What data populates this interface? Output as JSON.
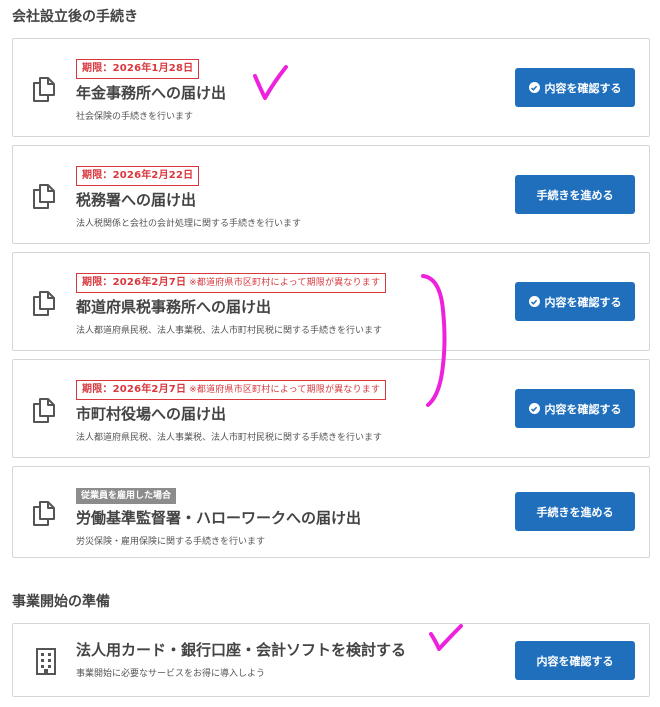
{
  "section1": {
    "title": "会社設立後の手続き"
  },
  "section2": {
    "title": "事業開始の準備"
  },
  "cards": [
    {
      "deadline": "期限：2026年1月28日",
      "title": "年金事務所への届け出",
      "desc": "社会保険の手続きを行います",
      "button": "内容を確認する"
    },
    {
      "deadline": "期限：2026年2月22日",
      "title": "税務署への届け出",
      "desc": "法人税関係と会社の会計処理に関する手続きを行います",
      "button": "手続きを進める"
    },
    {
      "deadline": "期限：2026年2月7日",
      "deadline_note": "※都道府県市区町村によって期限が異なります",
      "title": "都道府県税事務所への届け出",
      "desc": "法人都道府県民税、法人事業税、法人市町村民税に関する手続きを行います",
      "button": "内容を確認する"
    },
    {
      "deadline": "期限：2026年2月7日",
      "deadline_note": "※都道府県市区町村によって期限が異なります",
      "title": "市町村役場への届け出",
      "desc": "法人都道府県民税、法人事業税、法人市町村民税に関する手続きを行います",
      "button": "内容を確認する"
    },
    {
      "tag": "従業員を雇用した場合",
      "title": "労働基準監督署・ハローワークへの届け出",
      "desc": "労災保険・雇用保険に関する手続きを行います",
      "button": "手続きを進める"
    },
    {
      "title": "法人用カード・銀行口座・会計ソフトを検討する",
      "desc": "事業開始に必要なサービスをお得に導入しよう",
      "button": "内容を確認する"
    }
  ],
  "colors": {
    "accent": "#1f6fbd",
    "deadline": "#d9373d",
    "annotation": "#ee22dd",
    "tag": "#8c8c8c"
  },
  "icons": {
    "document": "documents-icon",
    "building": "building-icon",
    "check": "check-circle-icon"
  }
}
